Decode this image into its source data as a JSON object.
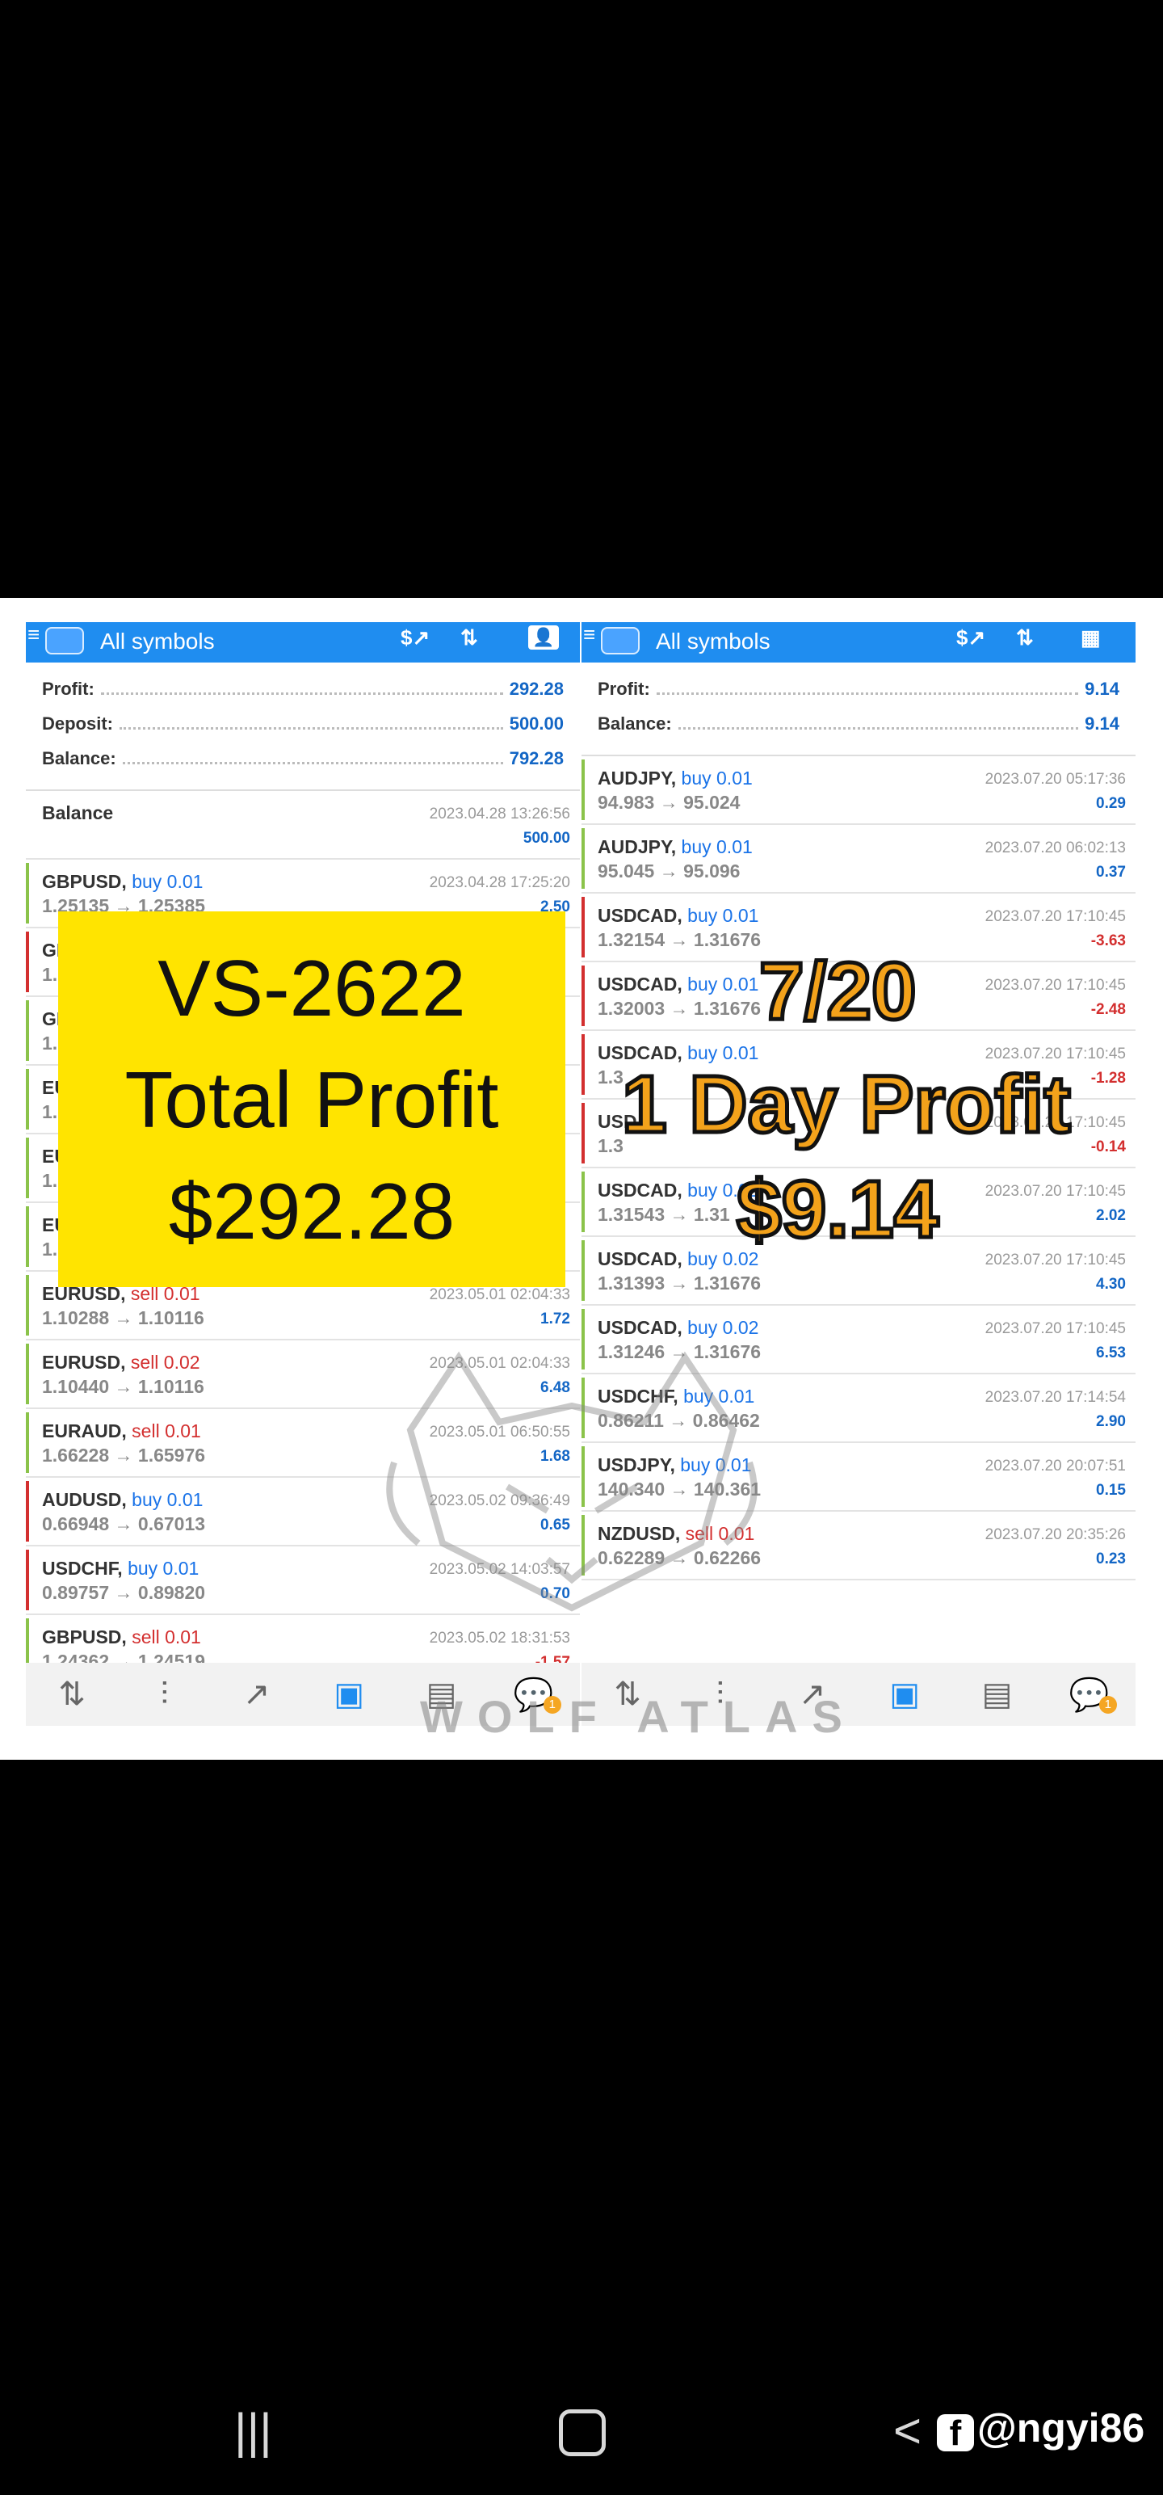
{
  "left": {
    "title": "All symbols",
    "summary": [
      {
        "label": "Profit:",
        "value": "292.28"
      },
      {
        "label": "Deposit:",
        "value": "500.00"
      },
      {
        "label": "Balance:",
        "value": "792.28"
      }
    ],
    "balance_row": {
      "label": "Balance",
      "time": "2023.04.28 13:26:56",
      "value": "500.00"
    },
    "trades": [
      {
        "symbol": "GBPUSD,",
        "side": "buy 0.01",
        "type": "buy",
        "price": "1.25135 → 1.25385",
        "time": "2023.04.28 17:25:20",
        "pl": "2.50",
        "bar": "#8bc34a"
      },
      {
        "symbol": "GI",
        "side": "",
        "type": "buy",
        "price": "1.",
        "time": "",
        "pl": "",
        "bar": "#d32f2f"
      },
      {
        "symbol": "GI",
        "side": "",
        "type": "buy",
        "price": "1.",
        "time": "",
        "pl": "",
        "bar": "#8bc34a"
      },
      {
        "symbol": "EU",
        "side": "",
        "type": "buy",
        "price": "1.",
        "time": "",
        "pl": "",
        "bar": "#8bc34a"
      },
      {
        "symbol": "EU",
        "side": "",
        "type": "buy",
        "price": "1.",
        "time": "",
        "pl": "",
        "bar": "#8bc34a"
      },
      {
        "symbol": "EU",
        "side": "",
        "type": "buy",
        "price": "1.",
        "time": "",
        "pl": "",
        "bar": "#8bc34a"
      },
      {
        "symbol": "EURUSD,",
        "side": "sell 0.01",
        "type": "sell",
        "price": "1.10288 → 1.10116",
        "time": "2023.05.01 02:04:33",
        "pl": "1.72",
        "bar": "#8bc34a"
      },
      {
        "symbol": "EURUSD,",
        "side": "sell 0.02",
        "type": "sell",
        "price": "1.10440 → 1.10116",
        "time": "2023.05.01 02:04:33",
        "pl": "6.48",
        "bar": "#8bc34a"
      },
      {
        "symbol": "EURAUD,",
        "side": "sell 0.01",
        "type": "sell",
        "price": "1.66228 → 1.65976",
        "time": "2023.05.01 06:50:55",
        "pl": "1.68",
        "bar": "#8bc34a"
      },
      {
        "symbol": "AUDUSD,",
        "side": "buy 0.01",
        "type": "buy",
        "price": "0.66948 → 0.67013",
        "time": "2023.05.02 09:36:49",
        "pl": "0.65",
        "bar": "#d32f2f"
      },
      {
        "symbol": "USDCHF,",
        "side": "buy 0.01",
        "type": "buy",
        "price": "0.89757 → 0.89820",
        "time": "2023.05.02 14:03:57",
        "pl": "0.70",
        "bar": "#d32f2f"
      },
      {
        "symbol": "GBPUSD,",
        "side": "sell 0.01",
        "type": "sell",
        "price": "1.24362 → 1.24519",
        "time": "2023.05.02 18:31:53",
        "pl": "-1.57",
        "bar": "#8bc34a"
      }
    ],
    "banner": [
      "VS-2622",
      "Total Profit",
      "$292.28"
    ]
  },
  "right": {
    "title": "All symbols",
    "summary": [
      {
        "label": "Profit:",
        "value": "9.14"
      },
      {
        "label": "Balance:",
        "value": "9.14"
      }
    ],
    "trades": [
      {
        "symbol": "AUDJPY,",
        "side": "buy 0.01",
        "type": "buy",
        "price": "94.983 → 95.024",
        "time": "2023.07.20 05:17:36",
        "pl": "0.29",
        "bar": "#8bc34a"
      },
      {
        "symbol": "AUDJPY,",
        "side": "buy 0.01",
        "type": "buy",
        "price": "95.045 → 95.096",
        "time": "2023.07.20 06:02:13",
        "pl": "0.37",
        "bar": "#8bc34a"
      },
      {
        "symbol": "USDCAD,",
        "side": "buy 0.01",
        "type": "buy",
        "price": "1.32154 → 1.31676",
        "time": "2023.07.20 17:10:45",
        "pl": "-3.63",
        "bar": "#d32f2f"
      },
      {
        "symbol": "USDCAD,",
        "side": "buy 0.01",
        "type": "buy",
        "price": "1.32003 → 1.31676",
        "time": "2023.07.20 17:10:45",
        "pl": "-2.48",
        "bar": "#d32f2f"
      },
      {
        "symbol": "USDCAD,",
        "side": "buy 0.01",
        "type": "buy",
        "price": "1.3",
        "time": "2023.07.20 17:10:45",
        "pl": "-1.28",
        "bar": "#d32f2f"
      },
      {
        "symbol": "USD",
        "side": "",
        "type": "buy",
        "price": "1.3",
        "time": "2023.07.20 17:10:45",
        "pl": "-0.14",
        "bar": "#d32f2f"
      },
      {
        "symbol": "USDCAD,",
        "side": "buy 0.02",
        "type": "buy",
        "price": "1.31543 → 1.31",
        "time": "2023.07.20 17:10:45",
        "pl": "2.02",
        "bar": "#8bc34a"
      },
      {
        "symbol": "USDCAD,",
        "side": "buy 0.02",
        "type": "buy",
        "price": "1.31393 → 1.31676",
        "time": "2023.07.20 17:10:45",
        "pl": "4.30",
        "bar": "#8bc34a"
      },
      {
        "symbol": "USDCAD,",
        "side": "buy 0.02",
        "type": "buy",
        "price": "1.31246 → 1.31676",
        "time": "2023.07.20 17:10:45",
        "pl": "6.53",
        "bar": "#8bc34a"
      },
      {
        "symbol": "USDCHF,",
        "side": "buy 0.01",
        "type": "buy",
        "price": "0.86211 → 0.86462",
        "time": "2023.07.20 17:14:54",
        "pl": "2.90",
        "bar": "#8bc34a"
      },
      {
        "symbol": "USDJPY,",
        "side": "buy 0.01",
        "type": "buy",
        "price": "140.340 → 140.361",
        "time": "2023.07.20 20:07:51",
        "pl": "0.15",
        "bar": "#8bc34a"
      },
      {
        "symbol": "NZDUSD,",
        "side": "sell 0.01",
        "type": "sell",
        "price": "0.62289 → 0.62266",
        "time": "2023.07.20 20:35:26",
        "pl": "0.23",
        "bar": "#8bc34a"
      }
    ],
    "banner": [
      "7/20",
      "1 Day Profit",
      "$9.14"
    ]
  },
  "watermark": "WOLF ATLAS",
  "footer": {
    "handle": "@ngyi86"
  },
  "colors": {
    "accent": "#1f8df0",
    "banner": "#ffe400",
    "overlay": "#f3a21b"
  }
}
